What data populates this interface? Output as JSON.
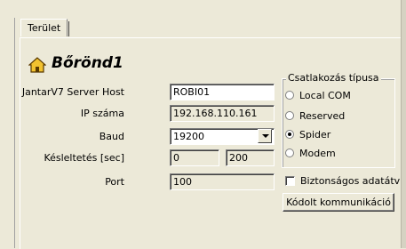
{
  "tab": {
    "label": "Terület"
  },
  "title": "Bőrönd1",
  "icons": {
    "title": "home-icon"
  },
  "form": {
    "host_label": "JantarV7 Server Host",
    "host_value": "ROBI01",
    "ip_label": "IP száma",
    "ip_value": "192.168.110.161",
    "baud_label": "Baud",
    "baud_value": "19200",
    "delay_label": "Késleltetés [sec]",
    "delay_value1": "0",
    "delay_value2": "200",
    "port_label": "Port",
    "port_value": "100"
  },
  "connection": {
    "title": "Csatlakozás típusa",
    "options": [
      "Local COM",
      "Reserved",
      "Spider",
      "Modem"
    ],
    "selected": "Spider"
  },
  "secure_label": "Biztonságos adatátv",
  "encoded_button": "Kódolt kommunikáció",
  "colors": {
    "background": "#ece9d8",
    "field_white": "#ffffff",
    "title_icon": "#b8860b"
  }
}
